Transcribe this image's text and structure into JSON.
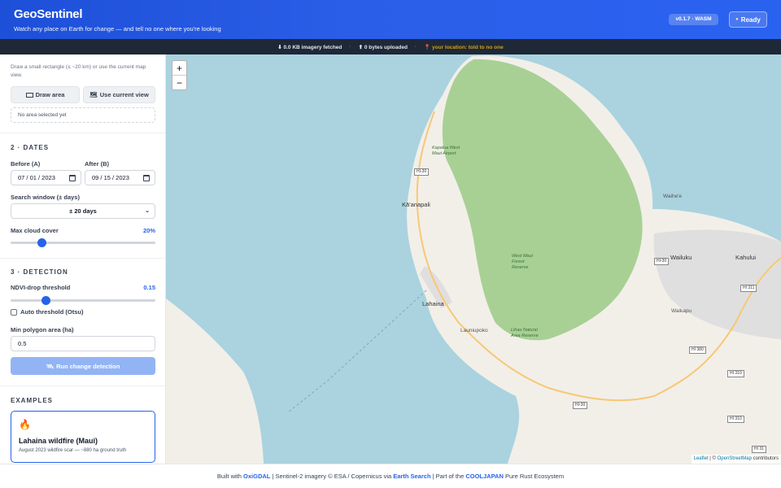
{
  "header": {
    "brand": "GeoSentinel",
    "tagline": "Watch any place on Earth for change — and tell no one where you're looking",
    "version": "v0.1.7 · WASM",
    "status_label": "Ready",
    "status_icon": "dot-icon"
  },
  "statusbar": {
    "fetched": "⬇ 0.0 KB imagery fetched",
    "uploaded": "⬆ 0 bytes uploaded",
    "location": "📍 your location: told to no one"
  },
  "area": {
    "hint": "Draw a small rectangle (≤ ~20 km) or use the current map view.",
    "draw_label": "Draw area",
    "draw_icon": "rectangle-icon",
    "view_label": "Use current view",
    "view_icon": "map-icon",
    "status": "No area selected yet"
  },
  "dates": {
    "title": "2 · DATES",
    "before_label": "Before (A)",
    "before_value": "07 / 01 / 2023",
    "after_label": "After (B)",
    "after_value": "09 / 15 / 2023",
    "window_label": "Search window (± days)",
    "window_value": "± 20 days",
    "cloud_label": "Max cloud cover",
    "cloud_value": "20%",
    "cloud_fraction": 0.2
  },
  "detection": {
    "title": "3 · DETECTION",
    "ndvi_label": "NDVI-drop threshold",
    "ndvi_value": "0.15",
    "ndvi_fraction": 0.23,
    "otsu_label": "Auto threshold (Otsu)",
    "otsu_checked": false,
    "min_area_label": "Min polygon area (ha)",
    "min_area_value": "0.5",
    "run_label": "Run change detection",
    "run_icon": "satellite-icon"
  },
  "examples": {
    "title": "EXAMPLES",
    "items": [
      {
        "icon": "🔥",
        "title": "Lahaina wildfire (Maui)",
        "desc": "August 2023 wildfire scar — ~880 ha ground truth"
      }
    ]
  },
  "map": {
    "zoom_in": "+",
    "zoom_out": "−",
    "attribution_leaflet": "Leaflet",
    "attribution_sep": " | © ",
    "attribution_osm": "OpenStreetMap",
    "attribution_tail": " contributors",
    "labels": {
      "kaanapali": "Kā'anapali",
      "lahaina": "Lahaina",
      "launiupoko": "Launiupoko",
      "wailuku": "Wailuku",
      "kahului": "Kahului",
      "waihee": "Waihe'e",
      "waikapu": "Waikapu",
      "airport": "Kapalua West Maui Airport",
      "forest": "West Maui Forest Reserve",
      "natural_area": "Lihau Natural Area Reserve"
    },
    "shields": {
      "hi30_a": "HI-30",
      "hi30_b": "HI-30",
      "hi30_c": "HI-30",
      "hi311": "HI 311",
      "hi380": "HI 380",
      "hi310_a": "HI 310",
      "hi310_b": "HI 310",
      "hi31": "HI 31"
    },
    "colors": {
      "ocean": "#aad3df",
      "land": "#f2efe9",
      "forest": "#a8d095",
      "urban": "#e0dfdf"
    }
  },
  "footer": {
    "prefix": "Built with ",
    "oxigdal": "OxiGDAL",
    "mid1": " | Sentinel-2 imagery © ESA / Copernicus via ",
    "earth_search": "Earth Search",
    "mid2": " | Part of the ",
    "cooljapan": "COOLJAPAN",
    "suffix": " Pure Rust Ecosystem"
  }
}
